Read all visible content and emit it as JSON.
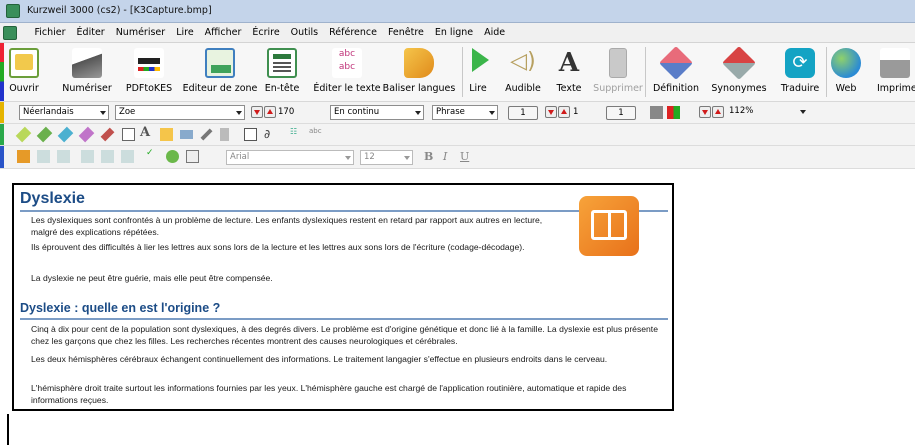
{
  "window": {
    "title": "Kurzweil 3000 (cs2) - [K3Capture.bmp]"
  },
  "menu": [
    "Fichier",
    "Éditer",
    "Numériser",
    "Lire",
    "Afficher",
    "Écrire",
    "Outils",
    "Référence",
    "Fenêtre",
    "En ligne",
    "Aide"
  ],
  "toolbar": {
    "open": "Ouvrir",
    "scan": "Numériser",
    "pdftokes": "PDFtoKES",
    "zone_editor": "Editeur de zone",
    "header": "En-tête",
    "edit_text": "Éditer le texte",
    "bookmark_tags": "Baliser langues",
    "read": "Lire",
    "audible": "Audible",
    "text": "Texte",
    "delete": "Supprimer",
    "definition": "Définition",
    "synonyms": "Synonymes",
    "translate": "Traduire",
    "web": "Web",
    "print": "Imprime"
  },
  "format_bar": {
    "language": "Néerlandais",
    "zoom_mode": "Zoe",
    "speed": "170",
    "reading_mode": "En continu",
    "unit": "Phrase",
    "page_value": "1",
    "step_value": "1",
    "step_value2": "1",
    "zoom": "112%"
  },
  "write_bar": {
    "font": "Arial",
    "size": "12",
    "bold": "B",
    "italic": "I",
    "underline": "U"
  },
  "icons": {
    "brand": "#3a8f5a",
    "accent_heading": "#1c4c86",
    "icon_orange": "#ee8a1d"
  },
  "document": {
    "heading1": "Dyslexie",
    "p1": "Les dyslexiques sont confrontés à un problème de lecture. Les enfants dyslexiques restent en retard par rapport aux autres en lecture, malgré des explications répétées.",
    "p2": "Ils éprouvent des difficultés à lier les lettres aux sons lors de la lecture et les lettres aux sons lors de l'écriture (codage-décodage).",
    "p3": "La dyslexie ne peut être guérie, mais elle peut être compensée.",
    "heading2": "Dyslexie : quelle en est l'origine ?",
    "p4": "Cinq à dix pour cent de la population sont dyslexiques, à des degrés divers. Le problème est d'origine génétique et donc lié à la famille. La dyslexie est plus présente chez les garçons que chez les filles. Les recherches récentes montrent des causes neurologiques et cérébrales.",
    "p5": "Les deux hémisphères cérébraux échangent continuellement des informations. Le traitement langagier s'effectue en plusieurs endroits dans le cerveau.",
    "p6": "L'hémisphère droit  traite surtout les informations fournies par les yeux. L'hémisphère gauche est chargé de l'application routinière, automatique et rapide des informations reçues."
  }
}
